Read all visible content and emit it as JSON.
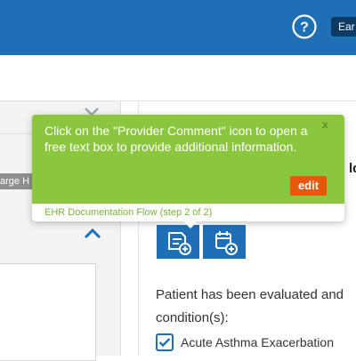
{
  "header": {
    "help_icon": "question-circle-icon",
    "user_label": "Ear"
  },
  "left_panel": {
    "tab_label": "arge H",
    "chevron_top_icon": "chevron-down-icon",
    "chevron_up_icon": "chevron-up-icon"
  },
  "main": {
    "heading": "ld",
    "buttons": [
      {
        "icon": "provider-comment-icon"
      },
      {
        "icon": "calendar-add-icon"
      }
    ],
    "statement": "Patient has been evaluated and condition(s):",
    "conditions": [
      {
        "label": "Acute Asthma Exacerbation",
        "checked": true
      }
    ]
  },
  "tooltip": {
    "text": "Click on the \"Provider Comment\" icon to open a free text box to provide additional information.",
    "close_label": "x",
    "edit_label": "edit",
    "footer": "EHR Documentation Flow (step 2 of 2)"
  },
  "colors": {
    "brand_blue": "#1e6fb6",
    "tooltip_green": "#8cc63f",
    "edit_orange": "#e8580c"
  }
}
